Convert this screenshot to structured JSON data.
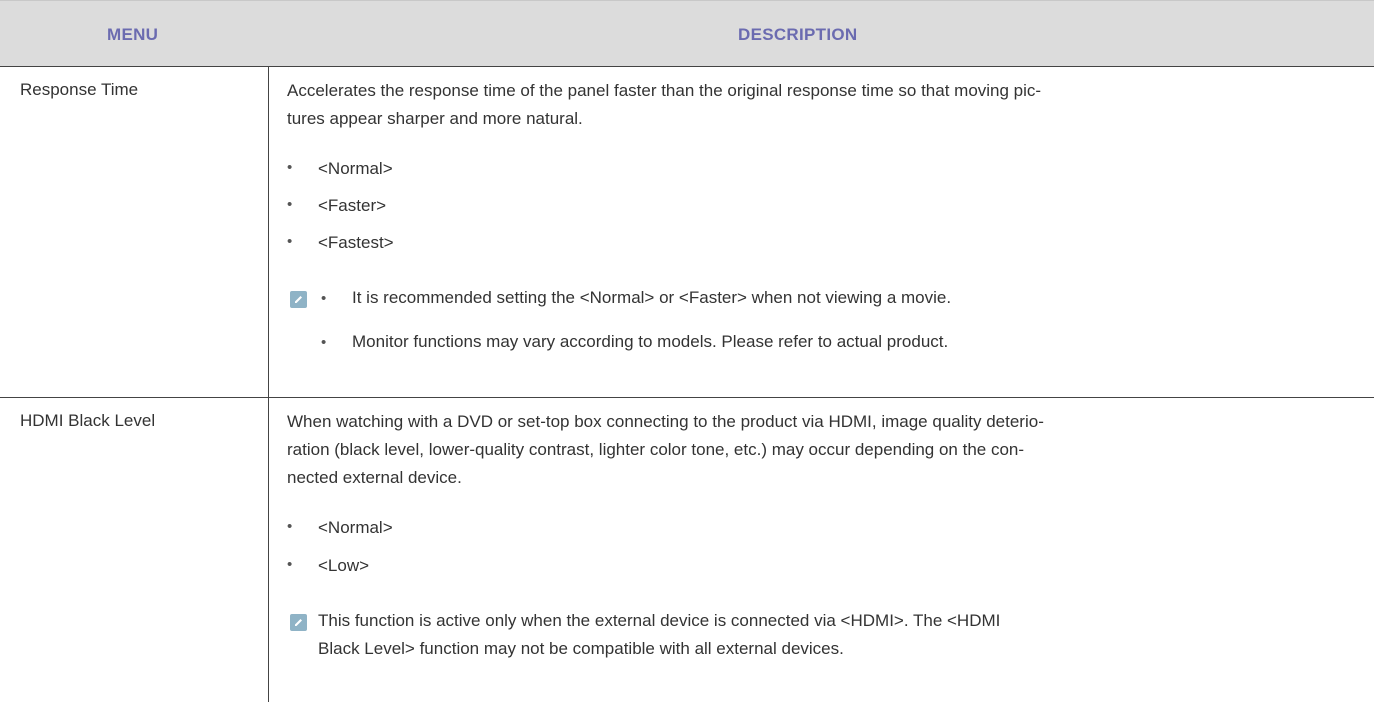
{
  "header": {
    "menu_label": "MENU",
    "description_label": "DESCRIPTION"
  },
  "rows": [
    {
      "menu": "Response Time",
      "description_lines": [
        "Accelerates the response time of the panel faster than the original response time so that moving pic-",
        "tures appear sharper and more natural."
      ],
      "options": [
        "<Normal>",
        "<Faster>",
        "<Fastest>"
      ],
      "notes": [
        "It is recommended setting the <Normal> or <Faster> when not viewing a movie.",
        "Monitor functions may vary according to models. Please refer to actual product."
      ]
    },
    {
      "menu": "HDMI Black Level",
      "description_lines": [
        "When watching with a DVD or set-top box connecting to the product via HDMI, image quality deterio-",
        "ration (black level, lower-quality contrast, lighter color tone, etc.) may occur depending on the con-",
        "nected external device."
      ],
      "options": [
        "<Normal>",
        "<Low>"
      ],
      "note_lines": [
        "This function is active only when the external device is connected via <HDMI>. The <HDMI",
        "Black Level> function may not be compatible with all external devices."
      ]
    }
  ],
  "icons": {
    "note": "note-pencil-icon",
    "bullet": "•"
  },
  "colors": {
    "header_bg": "#dcdcdc",
    "header_text": "#6b6bb0",
    "note_icon": "#8fb3c6",
    "body_text": "#333333"
  }
}
